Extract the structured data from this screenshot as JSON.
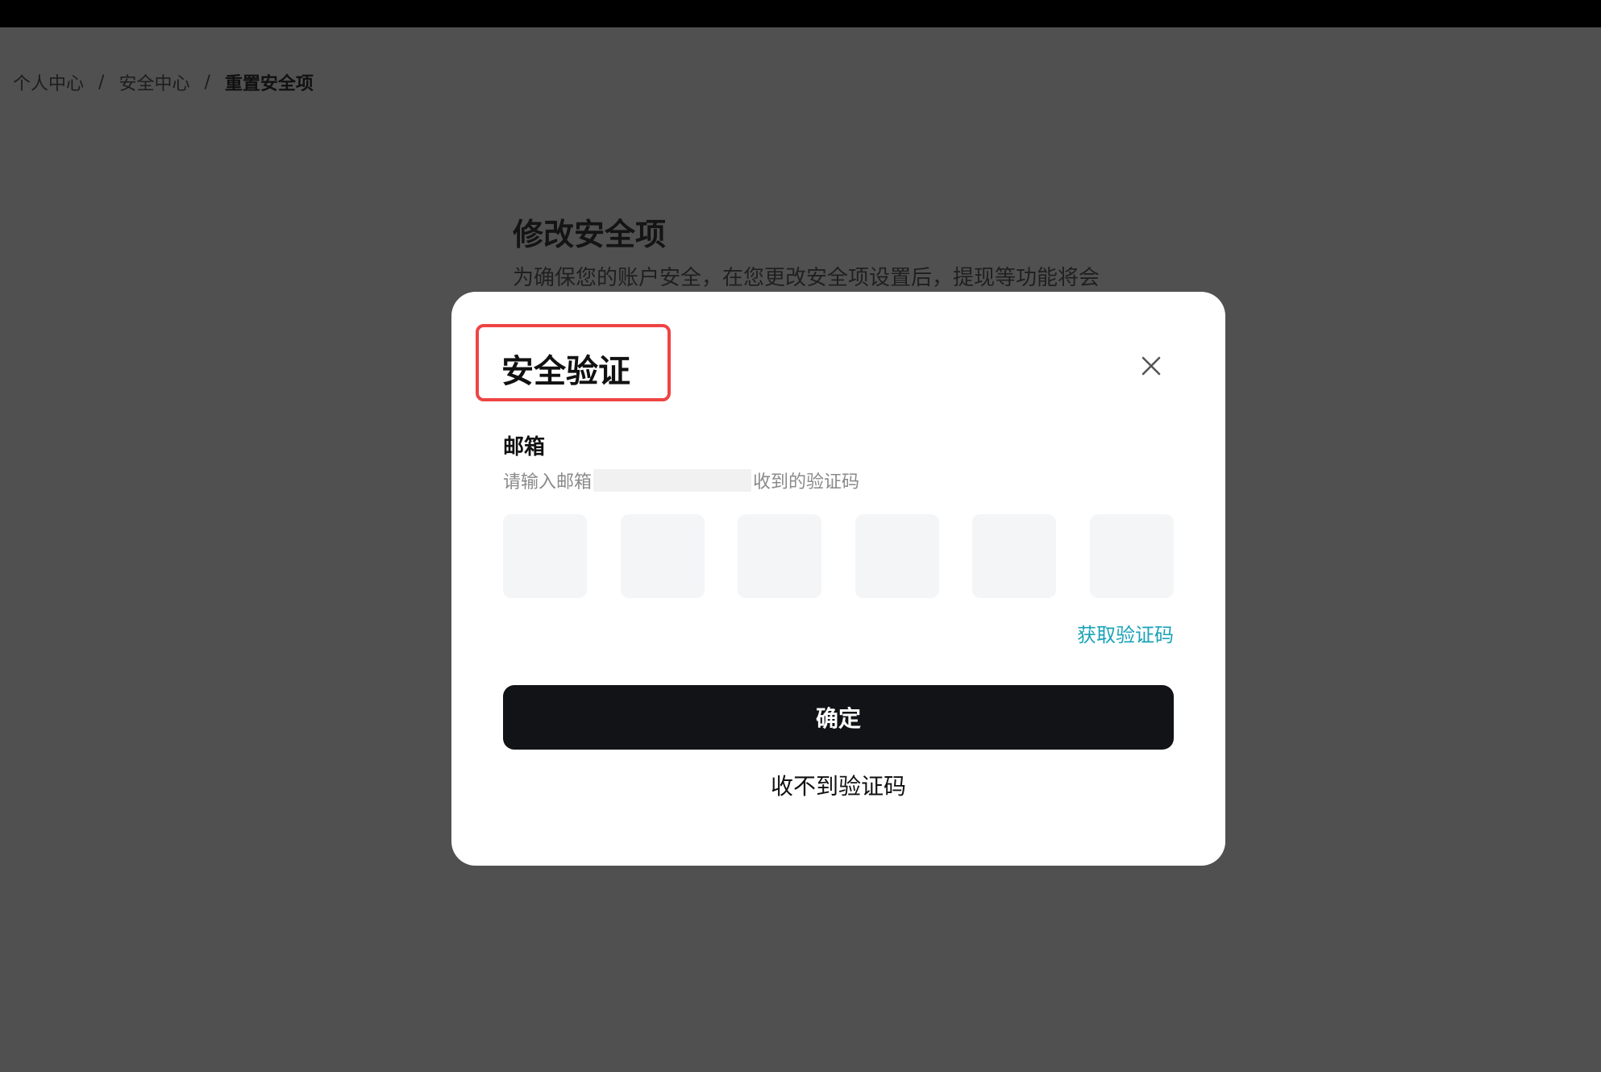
{
  "breadcrumb": {
    "items": [
      "个人中心",
      "安全中心",
      "重置安全项"
    ],
    "separator": "/"
  },
  "background": {
    "title": "修改安全项",
    "description": "为确保您的账户安全，在您更改安全项设置后，提现等功能将会"
  },
  "modal": {
    "title": "安全验证",
    "close_icon": "close-icon",
    "field_label": "邮箱",
    "hint_prefix": "请输入邮箱",
    "hint_suffix": "收到的验证码",
    "code_length": 6,
    "get_code_label": "获取验证码",
    "confirm_label": "确定",
    "no_code_label": "收不到验证码"
  },
  "colors": {
    "highlight_border": "#ef4444",
    "link": "#1aa3b8",
    "primary_button": "#121316",
    "overlay": "#505050"
  }
}
